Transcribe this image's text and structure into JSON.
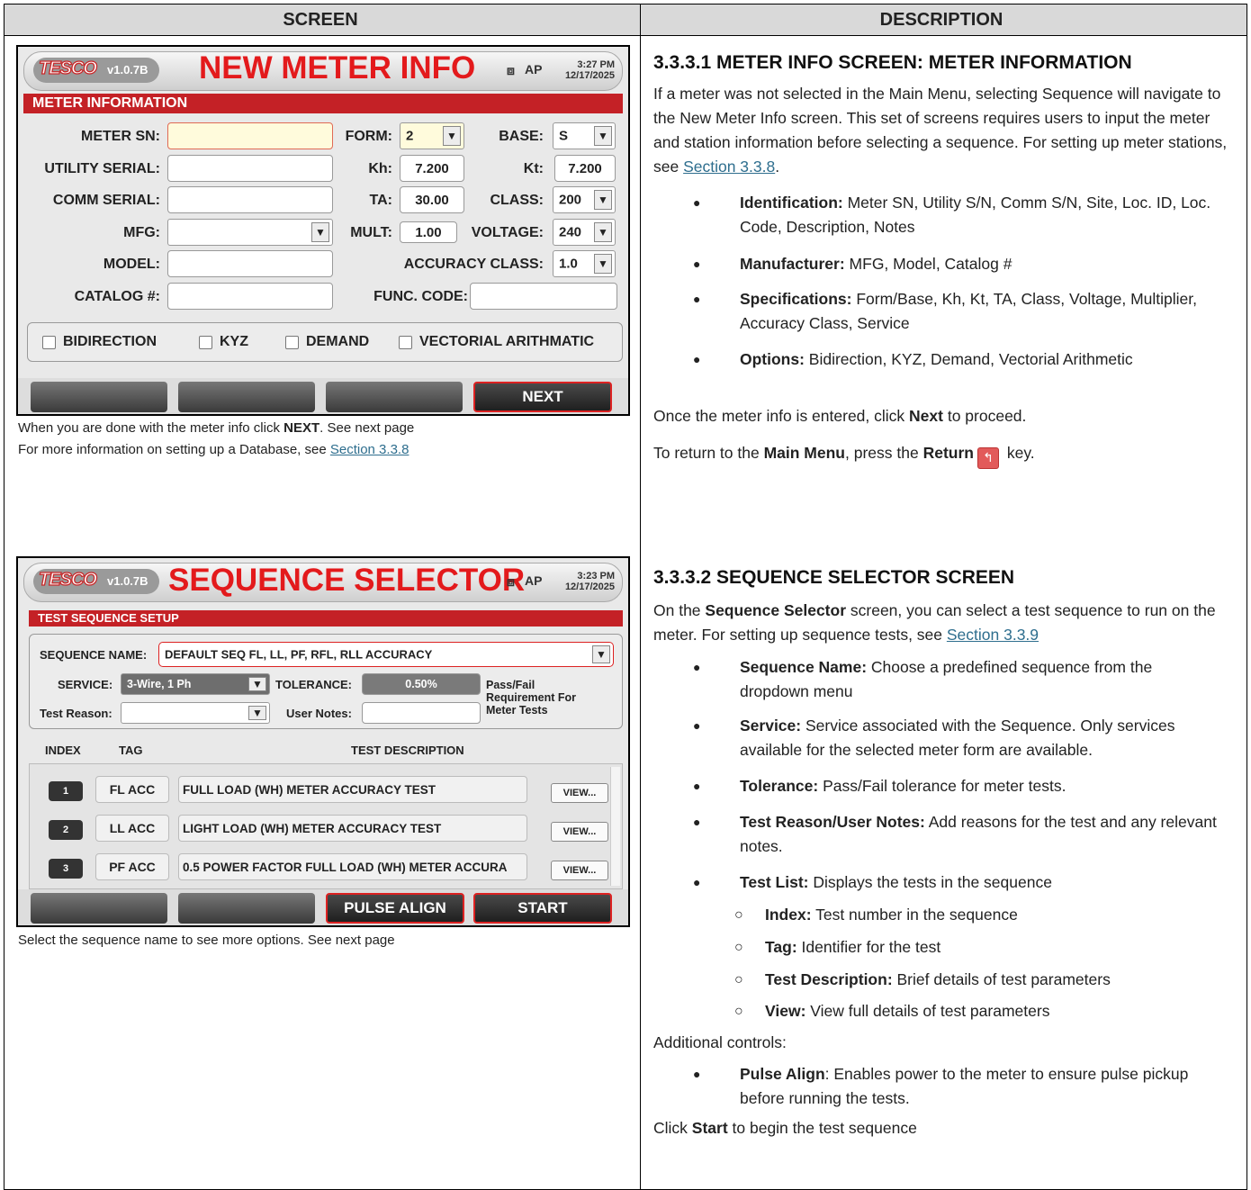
{
  "table": {
    "screen_header": "SCREEN",
    "description_header": "DESCRIPTION"
  },
  "screen1": {
    "logo": "TESCO",
    "version": "v1.0.7B",
    "title": "NEW METER INFO",
    "time": "3:27 PM",
    "date": "12/17/2025",
    "status_icon": "AP",
    "section": "METER INFORMATION",
    "labels": {
      "meter_sn": "METER SN:",
      "utility_serial": "UTILITY SERIAL:",
      "comm_serial": "COMM SERIAL:",
      "mfg": "MFG:",
      "model": "MODEL:",
      "catalog": "CATALOG #:",
      "form": "FORM:",
      "base": "BASE:",
      "kh": "Kh:",
      "kt": "Kt:",
      "ta": "TA:",
      "class": "CLASS:",
      "mult": "MULT:",
      "voltage": "VOLTAGE:",
      "accuracy_class": "ACCURACY CLASS:",
      "func_code": "FUNC. CODE:"
    },
    "values": {
      "form": "2",
      "base": "S",
      "kh": "7.200",
      "kt": "7.200",
      "ta": "30.00",
      "class": "200",
      "mult": "1.00",
      "voltage": "240",
      "accuracy_class": "1.0"
    },
    "options": [
      "BIDIRECTION",
      "KYZ",
      "DEMAND",
      "VECTORIAL ARITHMATIC"
    ],
    "next_button": "NEXT"
  },
  "caption1": {
    "line1_pre": "When you are done with the meter info click ",
    "line1_bold": "NEXT",
    "line1_post": ". See next page",
    "line2_pre": "For more information on setting up a Database, see ",
    "line2_link": "Section 3.3.8"
  },
  "desc1": {
    "heading": "3.3.3.1 METER INFO SCREEN: METER INFORMATION",
    "para": "If a meter was not selected in the Main Menu, selecting Sequence will navigate to the New Meter Info screen. This set of screens requires users to input the meter and station information before selecting a sequence. For setting up meter stations, see ",
    "para_link": "Section 3.3.8",
    "para_end": ".",
    "bullets": [
      {
        "bold": "Identification:",
        "text": " Meter SN, Utility S/N, Comm S/N, Site, Loc. ID, Loc. Code, Description, Notes"
      },
      {
        "bold": "Manufacturer:",
        "text": " MFG, Model, Catalog #"
      },
      {
        "bold": "Specifications:",
        "text": " Form/Base, Kh, Kt, TA, Class, Voltage, Multiplier, Accuracy Class, Service"
      },
      {
        "bold": "Options:",
        "text": " Bidirection, KYZ, Demand, Vectorial Arithmetic"
      }
    ],
    "next_pre": "Once the meter info is entered, click ",
    "next_bold": "Next",
    "next_post": " to proceed.",
    "ret_pre": "To return to the ",
    "ret_bold1": "Main Menu",
    "ret_mid": ", press the ",
    "ret_bold2": "Return",
    "ret_post": " key."
  },
  "screen2": {
    "logo": "TESCO",
    "version": "v1.0.7B",
    "title": "SEQUENCE SELECTOR",
    "time": "3:23 PM",
    "date": "12/17/2025",
    "status_icon": "AP",
    "section": "TEST SEQUENCE SETUP",
    "sequence_name_label": "SEQUENCE NAME:",
    "sequence_name_value": "DEFAULT SEQ FL, LL, PF, RFL, RLL ACCURACY",
    "service_label": "SERVICE:",
    "service_value": "3-Wire, 1 Ph",
    "tolerance_label": "TOLERANCE:",
    "tolerance_value": "0.50%",
    "tolerance_note": [
      "Pass/Fail",
      "Requirement For",
      "Meter Tests"
    ],
    "test_reason_label": "Test Reason:",
    "user_notes_label": "User Notes:",
    "columns": [
      "INDEX",
      "TAG",
      "TEST DESCRIPTION"
    ],
    "rows": [
      {
        "index": "1",
        "tag": "FL ACC",
        "desc": "FULL LOAD (WH) METER ACCURACY TEST",
        "view": "VIEW..."
      },
      {
        "index": "2",
        "tag": "LL ACC",
        "desc": "LIGHT LOAD (WH) METER ACCURACY TEST",
        "view": "VIEW..."
      },
      {
        "index": "3",
        "tag": "PF ACC",
        "desc": "0.5 POWER FACTOR FULL LOAD (WH) METER ACCURA",
        "view": "VIEW..."
      }
    ],
    "pulse_align_button": "PULSE ALIGN",
    "start_button": "START"
  },
  "caption2": "Select the sequence name to see more options. See next page",
  "desc2": {
    "heading": "3.3.3.2  SEQUENCE SELECTOR SCREEN",
    "para_pre": "On the ",
    "para_bold": "Sequence Selector",
    "para_mid": " screen, you can select a test sequence to run on the meter. For setting up sequence tests, see ",
    "para_link": "Section 3.3.9",
    "bullets": [
      {
        "bold": "Sequence Name:",
        "text": " Choose a predefined sequence from the dropdown menu"
      },
      {
        "bold": "Service:",
        "text": " Service associated with the Sequence. Only services available for the selected meter form are available."
      },
      {
        "bold": "Tolerance:",
        "text": " Pass/Fail tolerance for meter tests."
      },
      {
        "bold": "Test Reason/User Notes:",
        "text": " Add reasons for the test and any relevant notes."
      },
      {
        "bold": "Test List:",
        "text": " Displays the tests in the sequence"
      }
    ],
    "sub_bullets": [
      {
        "bold": "Index:",
        "text": " Test number in the sequence"
      },
      {
        "bold": "Tag:",
        "text": " Identifier for the test"
      },
      {
        "bold": "Test Description:",
        "text": " Brief details of test parameters"
      },
      {
        "bold": "View:",
        "text": " View full details of test parameters"
      }
    ],
    "additional": "Additional controls:",
    "pulse_bold": "Pulse Align",
    "pulse_text": ": Enables power to the meter to ensure pulse pickup before running the tests.",
    "start_pre": "Click ",
    "start_bold": "Start",
    "start_post": " to begin the test sequence"
  }
}
